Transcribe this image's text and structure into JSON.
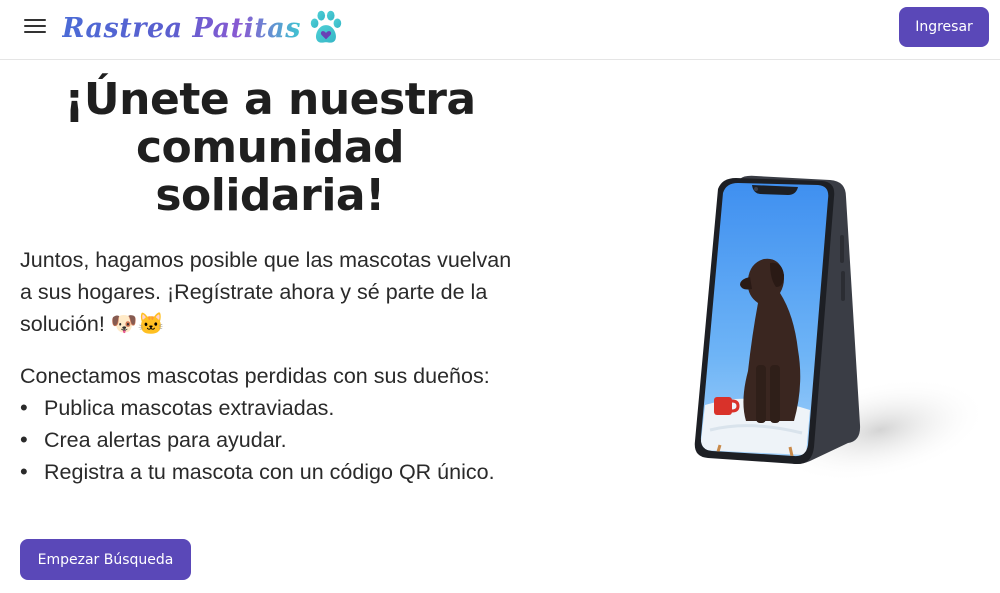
{
  "header": {
    "menu_icon": "hamburger-menu-icon",
    "logo_text": "Rastrea Patitas",
    "logo_icon": "paw-heart-icon",
    "login_label": "Ingresar"
  },
  "hero": {
    "title": "¡Únete a nuestra comunidad solidaria!",
    "intro": "Juntos, hagamos posible que las mascotas vuelvan a sus hogares. ¡Regístrate ahora y sé parte de la solución! 🐶🐱",
    "connect": "Conectamos mascotas perdidas con sus dueños:",
    "features": [
      "Publica mascotas extraviadas.",
      "Crea alertas para ayudar.",
      "Registra a tu mascota con un código QR único."
    ],
    "cta_label": "Empezar Búsqueda"
  },
  "colors": {
    "primary": "#5a48b8",
    "logo_blue": "#4b6bd6",
    "logo_purple": "#8a5ad2",
    "logo_teal": "#3ec5d1"
  }
}
